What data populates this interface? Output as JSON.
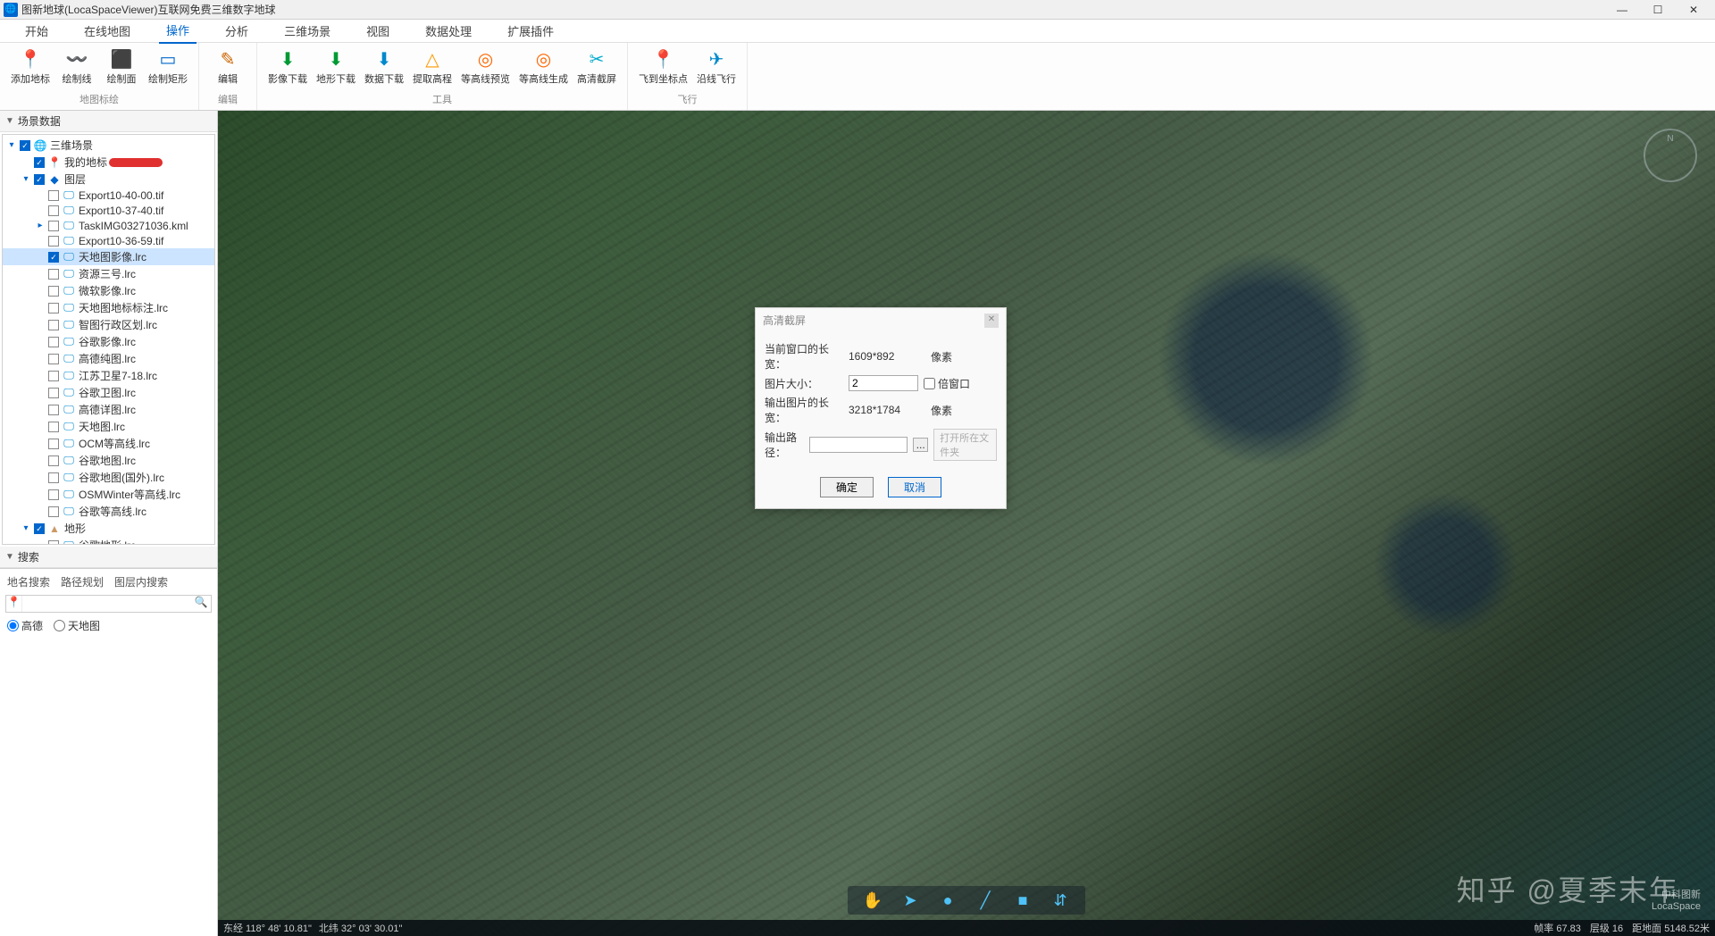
{
  "title": "图新地球(LocaSpaceViewer)互联网免费三维数字地球",
  "menus": [
    "开始",
    "在线地图",
    "操作",
    "分析",
    "三维场景",
    "视图",
    "数据处理",
    "扩展插件"
  ],
  "active_menu": 2,
  "ribbon": {
    "groups": [
      {
        "label": "地图标绘",
        "items": [
          {
            "icon": "📍",
            "label": "添加地标",
            "color": "#0066cc"
          },
          {
            "icon": "〰️",
            "label": "绘制线",
            "color": "#0066cc"
          },
          {
            "icon": "⬛",
            "label": "绘制面",
            "color": "#0066cc"
          },
          {
            "icon": "▭",
            "label": "绘制矩形",
            "color": "#0066cc"
          }
        ]
      },
      {
        "label": "编辑",
        "items": [
          {
            "icon": "✎",
            "label": "编辑",
            "color": "#cc6600"
          }
        ]
      },
      {
        "label": "工具",
        "items": [
          {
            "icon": "⬇",
            "label": "影像下载",
            "color": "#009933"
          },
          {
            "icon": "⬇",
            "label": "地形下载",
            "color": "#009933"
          },
          {
            "icon": "⬇",
            "label": "数据下载",
            "color": "#0088cc"
          },
          {
            "icon": "△",
            "label": "提取高程",
            "color": "#ff9900"
          },
          {
            "icon": "◎",
            "label": "等高线预览",
            "color": "#ff6600"
          },
          {
            "icon": "◎",
            "label": "等高线生成",
            "color": "#ff6600"
          },
          {
            "icon": "✂",
            "label": "高清截屏",
            "color": "#00aacc"
          }
        ]
      },
      {
        "label": "飞行",
        "items": [
          {
            "icon": "📍",
            "label": "飞到坐标点",
            "color": "#e03030"
          },
          {
            "icon": "✈",
            "label": "沿线飞行",
            "color": "#0088cc"
          }
        ]
      }
    ]
  },
  "panels": {
    "scene_data": "场景数据",
    "search": "搜索"
  },
  "tree": [
    {
      "depth": 0,
      "exp": "-",
      "checked": true,
      "icon": "🌐",
      "label": "三维场景",
      "iconc": "#0066cc"
    },
    {
      "depth": 1,
      "exp": "",
      "checked": true,
      "icon": "📍",
      "label": "我的地标",
      "redact": true,
      "iconc": "#0066cc"
    },
    {
      "depth": 1,
      "exp": "-",
      "checked": true,
      "icon": "◆",
      "label": "图层",
      "iconc": "#0066cc"
    },
    {
      "depth": 2,
      "exp": "",
      "checked": false,
      "icon": "🖵",
      "label": "Export10-40-00.tif",
      "iconc": "#0088cc"
    },
    {
      "depth": 2,
      "exp": "",
      "checked": false,
      "icon": "🖵",
      "label": "Export10-37-40.tif",
      "iconc": "#0088cc"
    },
    {
      "depth": 2,
      "exp": "+",
      "checked": false,
      "icon": "🖵",
      "label": "TaskIMG03271036.kml",
      "iconc": "#0088cc"
    },
    {
      "depth": 2,
      "exp": "",
      "checked": false,
      "icon": "🖵",
      "label": "Export10-36-59.tif",
      "iconc": "#0088cc"
    },
    {
      "depth": 2,
      "exp": "",
      "checked": true,
      "icon": "🖵",
      "label": "天地图影像.lrc",
      "iconc": "#0088cc",
      "selected": true
    },
    {
      "depth": 2,
      "exp": "",
      "checked": false,
      "icon": "🖵",
      "label": "资源三号.lrc",
      "iconc": "#0088cc"
    },
    {
      "depth": 2,
      "exp": "",
      "checked": false,
      "icon": "🖵",
      "label": "微软影像.lrc",
      "iconc": "#0088cc"
    },
    {
      "depth": 2,
      "exp": "",
      "checked": false,
      "icon": "🖵",
      "label": "天地图地标标注.lrc",
      "iconc": "#0088cc"
    },
    {
      "depth": 2,
      "exp": "",
      "checked": false,
      "icon": "🖵",
      "label": "智图行政区划.lrc",
      "iconc": "#0088cc"
    },
    {
      "depth": 2,
      "exp": "",
      "checked": false,
      "icon": "🖵",
      "label": "谷歌影像.lrc",
      "iconc": "#0088cc"
    },
    {
      "depth": 2,
      "exp": "",
      "checked": false,
      "icon": "🖵",
      "label": "高德纯图.lrc",
      "iconc": "#0088cc"
    },
    {
      "depth": 2,
      "exp": "",
      "checked": false,
      "icon": "🖵",
      "label": "江苏卫星7-18.lrc",
      "iconc": "#0088cc"
    },
    {
      "depth": 2,
      "exp": "",
      "checked": false,
      "icon": "🖵",
      "label": "谷歌卫图.lrc",
      "iconc": "#0088cc"
    },
    {
      "depth": 2,
      "exp": "",
      "checked": false,
      "icon": "🖵",
      "label": "高德详图.lrc",
      "iconc": "#0088cc"
    },
    {
      "depth": 2,
      "exp": "",
      "checked": false,
      "icon": "🖵",
      "label": "天地图.lrc",
      "iconc": "#0088cc"
    },
    {
      "depth": 2,
      "exp": "",
      "checked": false,
      "icon": "🖵",
      "label": "OCM等高线.lrc",
      "iconc": "#0088cc"
    },
    {
      "depth": 2,
      "exp": "",
      "checked": false,
      "icon": "🖵",
      "label": "谷歌地图.lrc",
      "iconc": "#0088cc"
    },
    {
      "depth": 2,
      "exp": "",
      "checked": false,
      "icon": "🖵",
      "label": "谷歌地图(国外).lrc",
      "iconc": "#0088cc"
    },
    {
      "depth": 2,
      "exp": "",
      "checked": false,
      "icon": "🖵",
      "label": "OSMWinter等高线.lrc",
      "iconc": "#0088cc"
    },
    {
      "depth": 2,
      "exp": "",
      "checked": false,
      "icon": "🖵",
      "label": "谷歌等高线.lrc",
      "iconc": "#0088cc"
    },
    {
      "depth": 1,
      "exp": "-",
      "checked": true,
      "icon": "▲",
      "label": "地形",
      "iconc": "#cc9966"
    },
    {
      "depth": 2,
      "exp": "",
      "checked": false,
      "icon": "🖵",
      "label": "谷歌地形.lrc",
      "iconc": "#0088cc"
    }
  ],
  "search": {
    "tabs": [
      "地名搜索",
      "路径规划",
      "图层内搜索"
    ],
    "radios": [
      "高德",
      "天地图"
    ],
    "selected_radio": 0
  },
  "dialog": {
    "title": "高清截屏",
    "rows": {
      "cur_label": "当前窗口的长宽：",
      "cur_val": "1609*892",
      "cur_unit": "像素",
      "size_label": "图片大小：",
      "size_val": "2",
      "size_chk": "倍窗口",
      "out_label": "输出图片的长宽：",
      "out_val": "3218*1784",
      "out_unit": "像素",
      "path_label": "输出路径：",
      "open_label": "打开所在文件夹"
    },
    "ok": "确定",
    "cancel": "取消"
  },
  "status": {
    "lon": "东经 118° 48' 10.81\"",
    "lat": "北纬 32° 03' 30.01\"",
    "frame": "帧率 67.83",
    "level": "层级 16",
    "dist": "距地面 5148.52米"
  },
  "watermark": "知乎 @夏季末年",
  "brand": "中科图新\nLocaSpace"
}
